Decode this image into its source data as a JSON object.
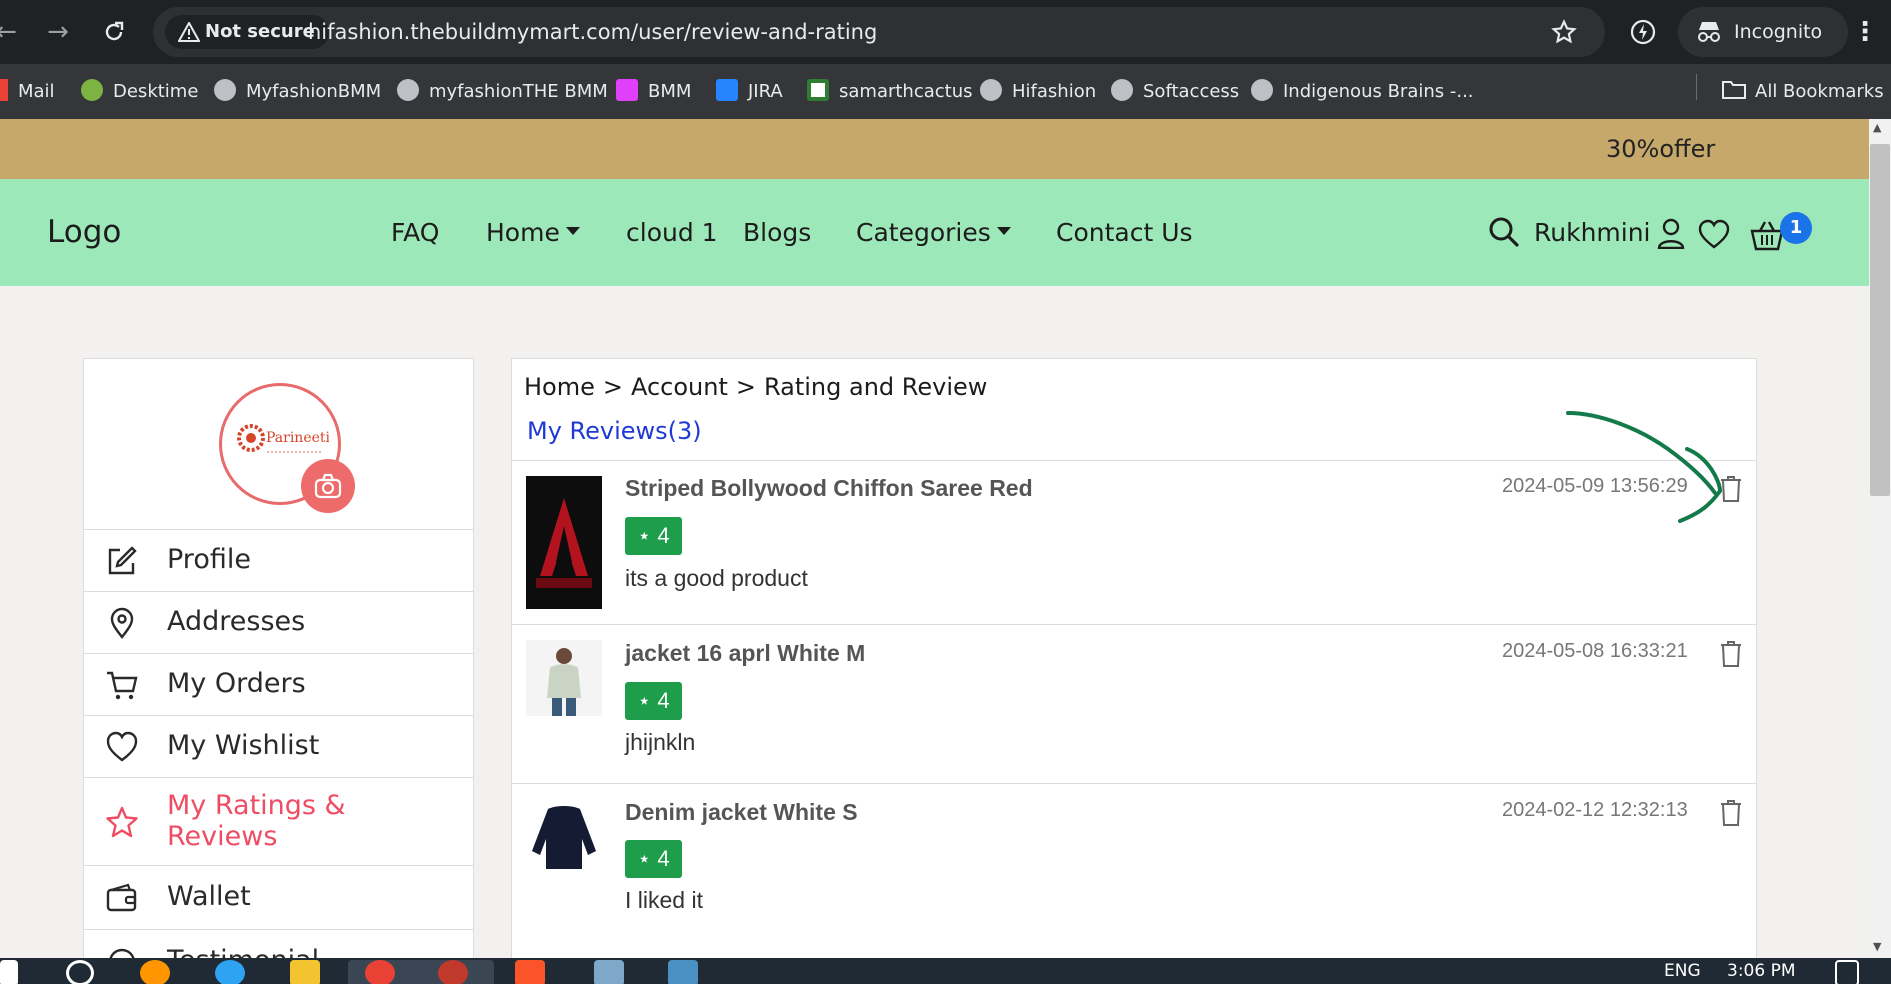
{
  "browser": {
    "security_label": "Not secure",
    "url": "hifashion.thebuildmymart.com/user/review-and-rating",
    "incognito_label": "Incognito",
    "bookmarks": [
      {
        "label": "Mail",
        "color": "#ea4335"
      },
      {
        "label": "Desktime",
        "color": "#7cb342"
      },
      {
        "label": "MyfashionBMM",
        "color": "#bdc1c6"
      },
      {
        "label": "myfashionTHE BMM",
        "color": "#bdc1c6"
      },
      {
        "label": "BMM",
        "color": "#e040fb"
      },
      {
        "label": "JIRA",
        "color": "#2684ff"
      },
      {
        "label": "samarthcactus",
        "color": "#ffffff"
      },
      {
        "label": "Hifashion",
        "color": "#bdc1c6"
      },
      {
        "label": "Softaccess",
        "color": "#bdc1c6"
      },
      {
        "label": "Indigenous Brains -...",
        "color": "#bdc1c6"
      }
    ],
    "all_bookmarks_label": "All Bookmarks"
  },
  "site": {
    "offer_text": "30%offer",
    "logo": "Logo",
    "nav": [
      {
        "label": "FAQ",
        "dropdown": false
      },
      {
        "label": "Home",
        "dropdown": true
      },
      {
        "label": "cloud 1",
        "dropdown": false
      },
      {
        "label": "Blogs",
        "dropdown": false
      },
      {
        "label": "Categories",
        "dropdown": true
      },
      {
        "label": "Contact Us",
        "dropdown": false
      }
    ],
    "user_name": "Rukhmini",
    "cart_count": "1",
    "colors": {
      "offer_bar": "#c6a96a",
      "header": "#9de8b8",
      "accent_pink": "#ee4d63",
      "link_blue": "#1f39d6",
      "rating_green": "#1e9d4b",
      "annotation_green": "#137a4a"
    }
  },
  "sidebar": {
    "avatar_brand": "Parineeti",
    "items": [
      {
        "label": "Profile",
        "icon": "edit-icon",
        "active": false
      },
      {
        "label": "Addresses",
        "icon": "map-pin-icon",
        "active": false
      },
      {
        "label": "My Orders",
        "icon": "cart-icon",
        "active": false
      },
      {
        "label": "My Wishlist",
        "icon": "heart-icon",
        "active": false
      },
      {
        "label": "My Ratings & Reviews",
        "icon": "star-icon",
        "active": true
      },
      {
        "label": "Wallet",
        "icon": "wallet-icon",
        "active": false
      },
      {
        "label": "Testimonial",
        "icon": "testimonial-icon",
        "active": false
      }
    ]
  },
  "reviews": {
    "breadcrumb": [
      "Home",
      "Account",
      "Rating and Review"
    ],
    "breadcrumb_separator": ">",
    "heading": "My Reviews(3)",
    "items": [
      {
        "title": "Striped Bollywood Chiffon Saree Red",
        "rating": "4",
        "text": "its a good product",
        "date": "2024-05-09 13:56:29",
        "thumb": "assassins-creed-cover"
      },
      {
        "title": "jacket 16 aprl White M",
        "rating": "4",
        "text": "jhijnkln",
        "date": "2024-05-08 16:33:21",
        "thumb": "jacket-woman-photo"
      },
      {
        "title": "Denim jacket White S",
        "rating": "4",
        "text": "I liked it",
        "date": "2024-02-12 12:32:13",
        "thumb": "navy-sweater-photo"
      }
    ]
  },
  "taskbar": {
    "language": "ENG",
    "time": "3:06 PM"
  }
}
